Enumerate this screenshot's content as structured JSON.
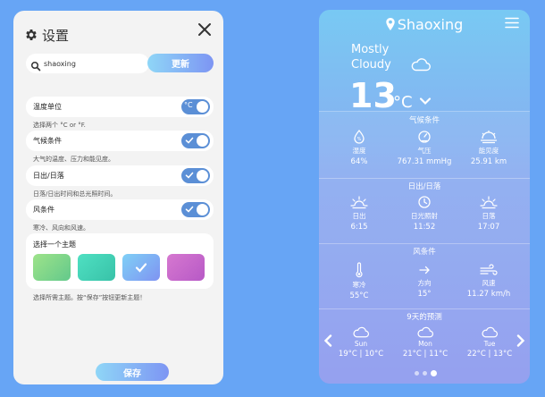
{
  "settings": {
    "title": "设置",
    "search": {
      "value": "shaoxing",
      "placeholder": ""
    },
    "update_label": "更新",
    "rows": [
      {
        "label": "温度单位",
        "desc": "选择两个 °C or °F.",
        "toggle_text": "°C",
        "on": true
      },
      {
        "label": "气候条件",
        "desc": "大气的温度、压力和能见度。",
        "on": true
      },
      {
        "label": "日出/日落",
        "desc": "日落/日出时间和总光照时间。",
        "on": true
      },
      {
        "label": "风条件",
        "desc": "寒冷、风向和风速。",
        "on": true
      }
    ],
    "theme_label": "选择一个主题",
    "themes": [
      {
        "name": "green",
        "from": "#9ee38a",
        "to": "#63c98b"
      },
      {
        "name": "teal",
        "from": "#4fe0c2",
        "to": "#38c2a8"
      },
      {
        "name": "blue",
        "from": "#7fd0f6",
        "to": "#7f93f2",
        "selected": true
      },
      {
        "name": "purple",
        "from": "#d678d0",
        "to": "#b759c6"
      }
    ],
    "footer_desc": "选择所需主题。按“保存”按钮更新主题！",
    "save_label": "保存"
  },
  "weather": {
    "city": "Shaoxing",
    "condition_line1": "Mostly",
    "condition_line2": "Cloudy",
    "temperature": "13",
    "unit": "°C",
    "climate": {
      "title": "气候条件",
      "items": [
        {
          "icon": "humidity-icon",
          "label": "湿度",
          "value": "64%"
        },
        {
          "icon": "pressure-icon",
          "label": "气压",
          "value": "767.31 mmHg"
        },
        {
          "icon": "visibility-icon",
          "label": "能见度",
          "value": "25.91 km"
        }
      ]
    },
    "sun": {
      "title": "日出/日落",
      "items": [
        {
          "icon": "sunrise-icon",
          "label": "日出",
          "value": "6:15"
        },
        {
          "icon": "daylight-clock-icon",
          "label": "日光照射",
          "value": "11:52"
        },
        {
          "icon": "sunset-icon",
          "label": "日落",
          "value": "17:07"
        }
      ]
    },
    "wind": {
      "title": "风条件",
      "items": [
        {
          "icon": "thermometer-icon",
          "label": "寒冷",
          "value": "55°C"
        },
        {
          "icon": "wind-direction-icon",
          "label": "方向",
          "value": "15°"
        },
        {
          "icon": "wind-speed-icon",
          "label": "风速",
          "value": "11.27 km/h"
        }
      ]
    },
    "forecast": {
      "title": "9天的预测",
      "days": [
        {
          "day": "Sun",
          "temps": "19°C | 10°C"
        },
        {
          "day": "Mon",
          "temps": "21°C | 11°C"
        },
        {
          "day": "Tue",
          "temps": "22°C | 13°C"
        }
      ]
    },
    "page_dots": 3,
    "active_dot": 2
  }
}
